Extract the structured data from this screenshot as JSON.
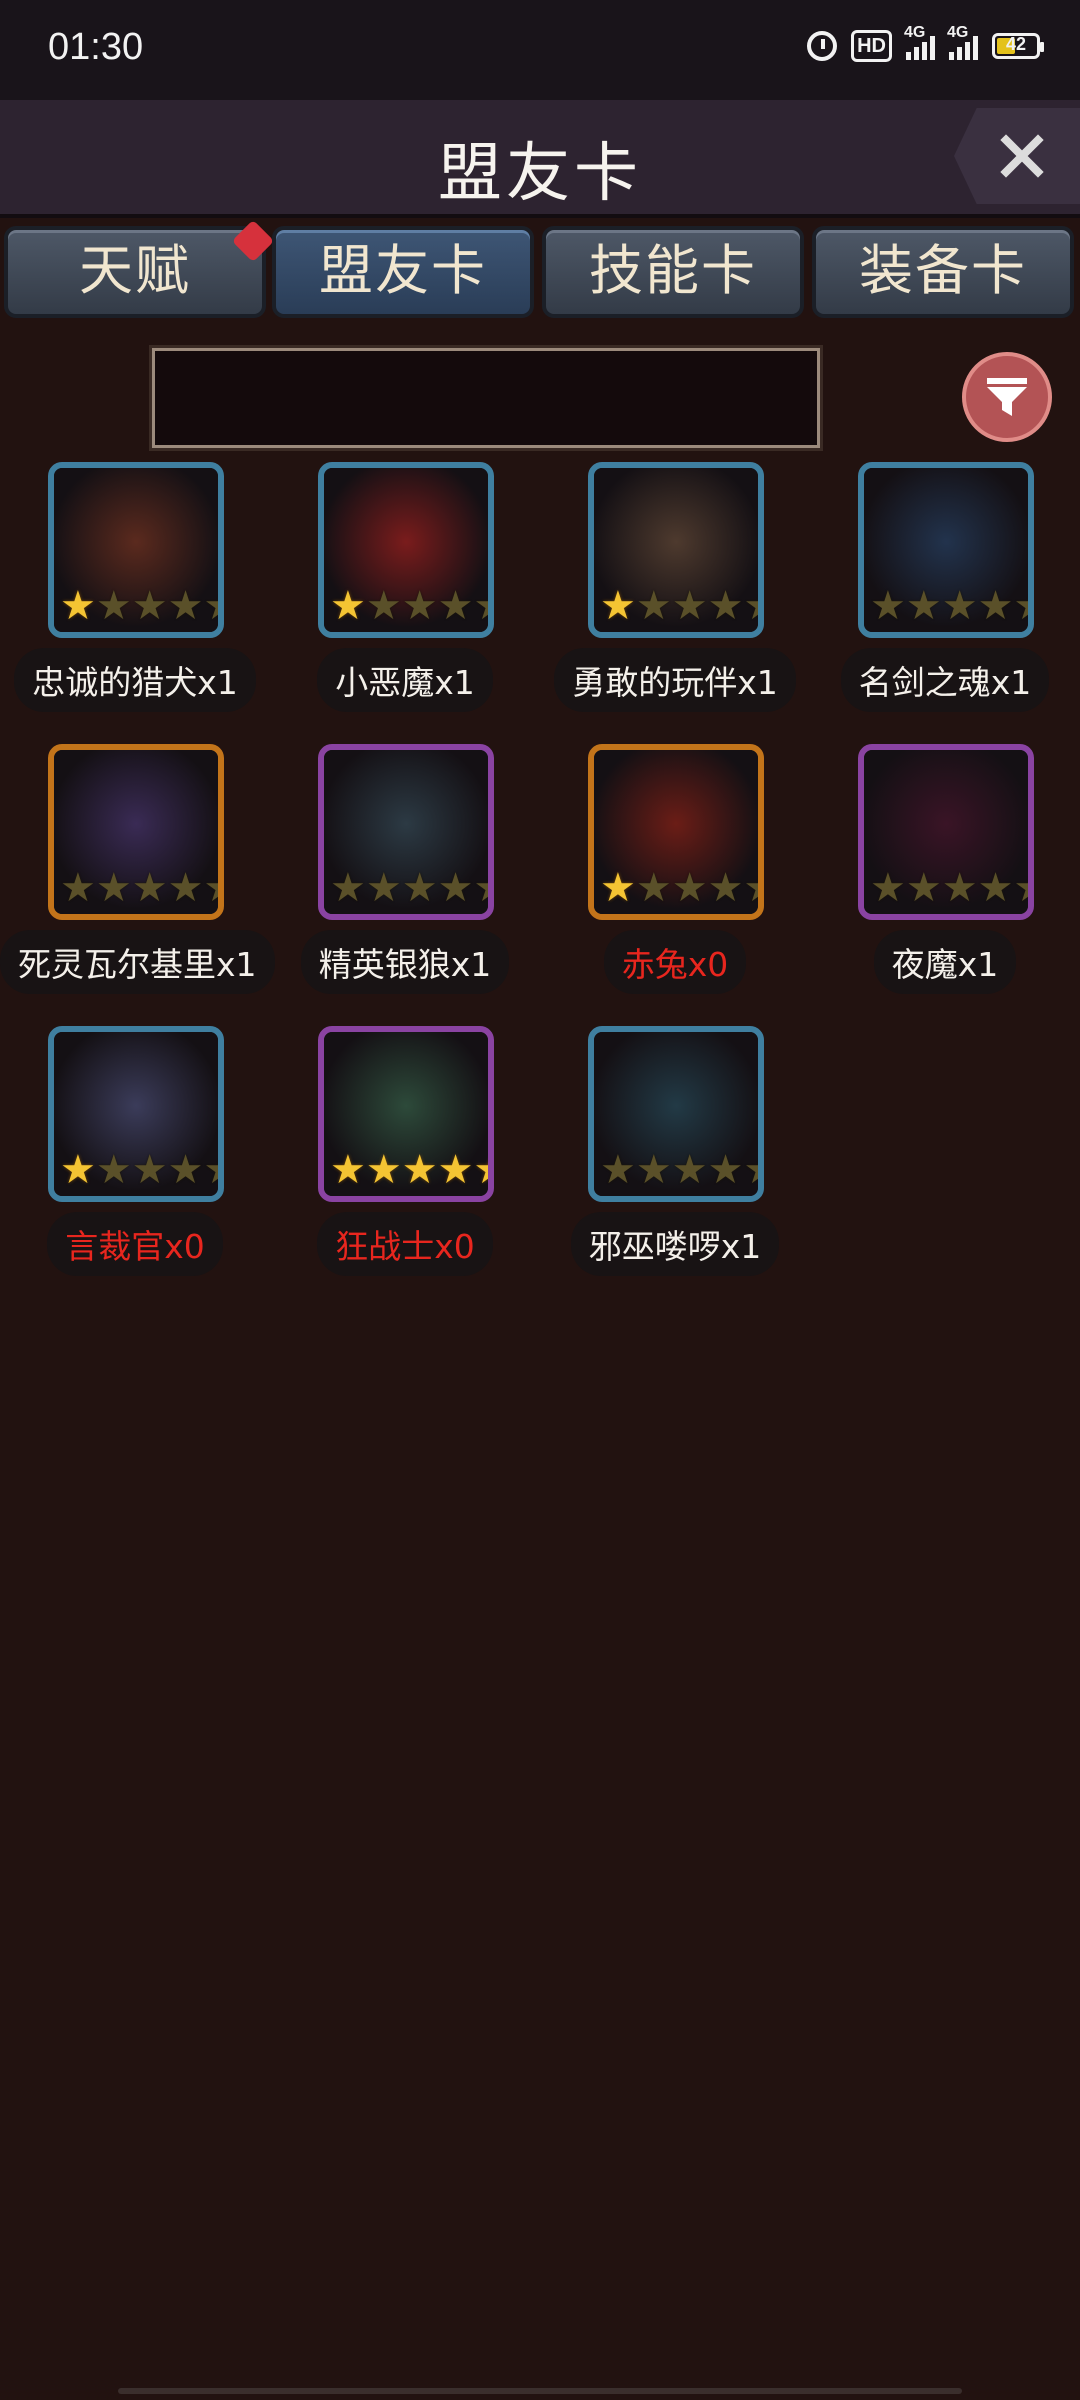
{
  "status_bar": {
    "time": "01:30",
    "hd_label": "HD",
    "sim1": "4G",
    "sim2": "4G",
    "battery": "42"
  },
  "header": {
    "title": "盟友卡",
    "close_icon": "close-x-icon"
  },
  "tabs": [
    {
      "label": "天赋",
      "badge": true
    },
    {
      "label": "盟友卡",
      "active": true
    },
    {
      "label": "技能卡"
    },
    {
      "label": "装备卡"
    }
  ],
  "search": {
    "value": "",
    "filter_icon": "filter-funnel-icon"
  },
  "cards": [
    {
      "name": "忠诚的猎犬x1",
      "stars": 1,
      "frame": "blue",
      "red": false
    },
    {
      "name": "小恶魔x1",
      "stars": 1,
      "frame": "blue",
      "red": false
    },
    {
      "name": "勇敢的玩伴x1",
      "stars": 1,
      "frame": "blue",
      "red": false
    },
    {
      "name": "名剑之魂x1",
      "stars": 0,
      "frame": "blue",
      "red": false
    },
    {
      "name": "死灵瓦尔基里x1",
      "stars": 0,
      "frame": "orange",
      "red": false
    },
    {
      "name": "精英银狼x1",
      "stars": 0,
      "frame": "purple",
      "red": false
    },
    {
      "name": "赤兔x0",
      "stars": 1,
      "frame": "orange",
      "red": true
    },
    {
      "name": "夜魔x1",
      "stars": 0,
      "frame": "purple",
      "red": false
    },
    {
      "name": "言裁官x0",
      "stars": 1,
      "frame": "blue",
      "red": true
    },
    {
      "name": "狂战士x0",
      "stars": 5,
      "frame": "purple",
      "red": true
    },
    {
      "name": "邪巫喽啰x1",
      "stars": 0,
      "frame": "blue",
      "red": false
    }
  ]
}
